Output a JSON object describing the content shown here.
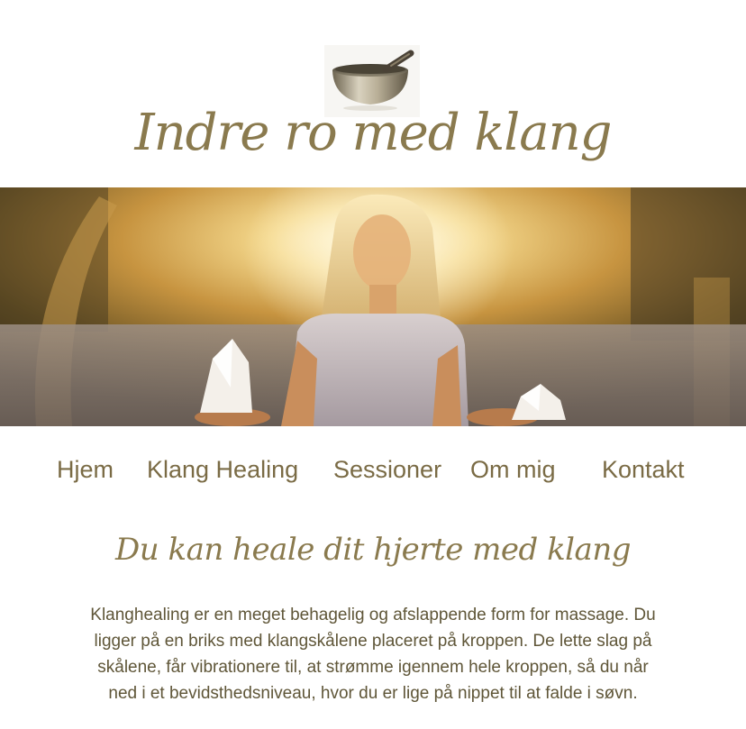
{
  "site": {
    "title": "Indre ro med klang"
  },
  "logo": {
    "icon": "singing-bowl-icon"
  },
  "hero": {
    "image": "woman-meditating-with-crystals-photo"
  },
  "nav": {
    "items": [
      {
        "label": "Hjem"
      },
      {
        "label": "Klang Healing"
      },
      {
        "label": "Sessioner"
      },
      {
        "label": "Om mig"
      },
      {
        "label": "Kontakt"
      }
    ]
  },
  "main": {
    "headline": "Du kan heale dit hjerte med klang",
    "paragraph": "Klanghealing er en meget behagelig og afslappende form for massage. Du ligger på en briks med klangskålene placeret på kroppen. De lette slag på skålene, får vibrationere til, at strømme igennem hele kroppen, så du når ned i et bevidsthedsniveau, hvor du er lige på nippet til at falde i søvn."
  },
  "colors": {
    "accent": "#8a7a4e",
    "text": "#5f5638",
    "background": "#ffffff"
  }
}
